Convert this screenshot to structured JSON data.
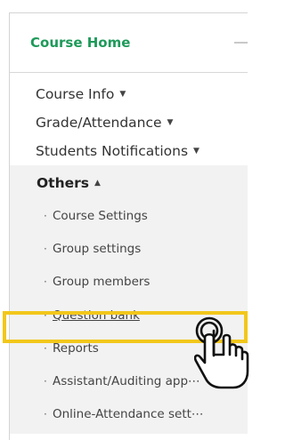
{
  "sidebar": {
    "title": "Course Home",
    "items": [
      {
        "label": "Course Info"
      },
      {
        "label": "Grade/Attendance"
      },
      {
        "label": "Students Notifications"
      }
    ],
    "group": {
      "label": "Others",
      "children": [
        {
          "label": "Course Settings"
        },
        {
          "label": "Group settings"
        },
        {
          "label": "Group members"
        },
        {
          "label": "Question bank"
        },
        {
          "label": "Reports"
        },
        {
          "label": "Assistant/Auditing app⋯"
        },
        {
          "label": "Online-Attendance sett⋯"
        }
      ]
    }
  },
  "icons": {
    "caret_down": "▼",
    "caret_up": "▲",
    "bullet": "·",
    "pointer": "hand-pointer-icon",
    "collapse": "minus-icon"
  },
  "colors": {
    "accent": "#1e9a5a",
    "highlight": "#f2c71b",
    "group_bg": "#f2f2f2"
  },
  "state": {
    "active_item": "Question bank"
  }
}
